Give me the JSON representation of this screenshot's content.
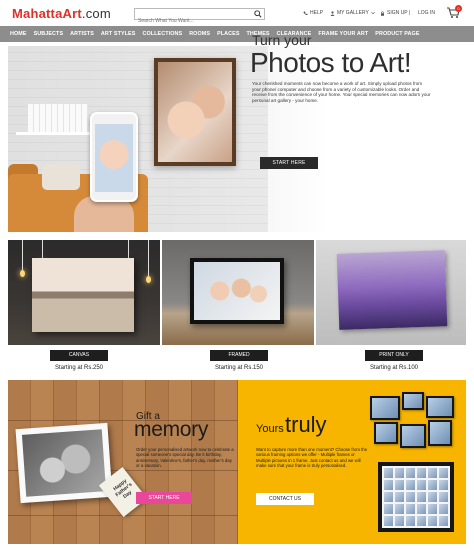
{
  "header": {
    "logo_main": "MahattaArt",
    "logo_suffix": ".com",
    "search_placeholder": "Search What You Want...",
    "help": "HELP",
    "gallery": "MY GALLERY",
    "signup": "SIGN UP |",
    "login": "LOG IN",
    "cart_count": "0"
  },
  "nav": [
    "HOME",
    "SUBJECTS",
    "ARTISTS",
    "ART STYLES",
    "COLLECTIONS",
    "ROOMS",
    "PLACES",
    "THEMES",
    "CLEARANCE",
    "FRAME YOUR ART",
    "PRODUCT PAGE"
  ],
  "hero": {
    "subtitle": "Turn your",
    "title": "Photos to Art!",
    "text": "Your cherished moments can now become a work of art. Simply upload photos from your phone/ computer and choose from a variety of customizable looks. Order and receive from the convenience of your home. Your special memories can now adorn your personal art gallery - your home.",
    "button": "START HERE"
  },
  "products": [
    {
      "label": "CANVAS",
      "price": "Starting at Rs.250"
    },
    {
      "label": "FRAMED",
      "price": "Starting at Rs.150"
    },
    {
      "label": "PRINT ONLY",
      "price": "Starting at Rs.100"
    }
  ],
  "gift": {
    "tag": "Happy Father's Day",
    "small": "Gift a",
    "big": "memory",
    "text": "Order your personalised artwork now to celebrate a special someone's special day. Be it birthday, anniversary, Valentine's, father's day, mother's day or a vacation.",
    "button": "START HERE",
    "button_color": "#e8479a"
  },
  "truly": {
    "small": "Yours",
    "big": "truly",
    "text": "Want to capture more than one moment? Choose from the various framing options we offer - Multiple frames or Multiple pictures in 1 frame. Just contact us and we will make sure that your frame is truly personalised.",
    "button": "CONTACT US",
    "bg_color": "#f7b500"
  }
}
